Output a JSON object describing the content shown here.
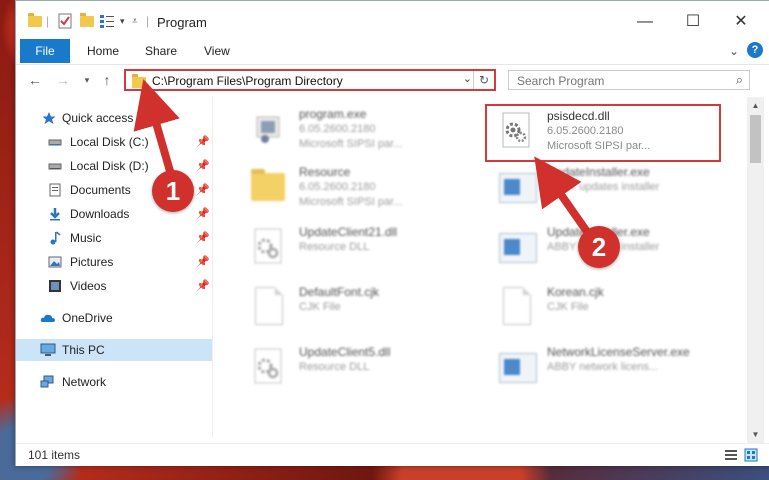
{
  "window": {
    "title": "Program",
    "controls": {
      "minimize": "—",
      "maximize": "☐",
      "close": "✕"
    }
  },
  "ribbon": {
    "tabs": [
      {
        "label": "File",
        "active": true
      },
      {
        "label": "Home"
      },
      {
        "label": "Share"
      },
      {
        "label": "View"
      }
    ],
    "help": "?"
  },
  "address": {
    "path": "C:\\Program Files\\Program Directory"
  },
  "search": {
    "placeholder": "Search Program"
  },
  "nav": {
    "items": [
      {
        "label": "Quick access",
        "icon": "star-icon"
      },
      {
        "label": "Local Disk (C:)",
        "icon": "drive-icon",
        "pinned": true
      },
      {
        "label": "Local Disk (D:)",
        "icon": "drive-icon",
        "pinned": true
      },
      {
        "label": "Documents",
        "icon": "documents-icon",
        "pinned": true
      },
      {
        "label": "Downloads",
        "icon": "download-icon",
        "pinned": true
      },
      {
        "label": "Music",
        "icon": "music-icon",
        "pinned": true
      },
      {
        "label": "Pictures",
        "icon": "pictures-icon",
        "pinned": true
      },
      {
        "label": "Videos",
        "icon": "videos-icon",
        "pinned": true
      },
      {
        "label": "OneDrive",
        "icon": "cloud-icon"
      },
      {
        "label": "This PC",
        "icon": "computer-icon",
        "selected": true
      },
      {
        "label": "Network",
        "icon": "network-icon"
      }
    ]
  },
  "files": [
    {
      "name": "program.exe",
      "line2": "6.05.2600.2180",
      "line3": "Microsoft SIPSI par...",
      "icon": "exe-icon"
    },
    {
      "name": "psisdecd.dll",
      "line2": "6.05.2600.2180",
      "line3": "Microsoft SIPSI par...",
      "icon": "dll-gear-icon",
      "highlighted": true
    },
    {
      "name": "Resource",
      "line2": "6.05.2600.2180",
      "line3": "Microsoft SIPSI par...",
      "icon": "folder-icon"
    },
    {
      "name": "UpdateInstaller.exe",
      "line2": "ABBY updates installer",
      "line3": "",
      "icon": "app-icon"
    },
    {
      "name": "UpdateClient21.dll",
      "line2": "Resource DLL",
      "line3": "",
      "icon": "dll-gear-icon"
    },
    {
      "name": "UpdateInstaller.exe",
      "line2": "ABBY updates installer",
      "line3": "",
      "icon": "app-icon"
    },
    {
      "name": "DefaultFont.cjk",
      "line2": "CJK File",
      "line3": "",
      "icon": "document-icon"
    },
    {
      "name": "Korean.cjk",
      "line2": "CJK File",
      "line3": "",
      "icon": "document-icon"
    },
    {
      "name": "UpdateClient5.dll",
      "line2": "Resource DLL",
      "line3": "",
      "icon": "dll-gear-icon"
    },
    {
      "name": "NetworkLicenseServer.exe",
      "line2": "ABBY network licens...",
      "line3": "",
      "icon": "app-icon"
    }
  ],
  "status": {
    "count": "101 items"
  },
  "annotations": [
    {
      "label": "1"
    },
    {
      "label": "2"
    }
  ],
  "colors": {
    "accent": "#1979ca",
    "highlight": "#d43a3a",
    "selected": "#cce4f7"
  }
}
